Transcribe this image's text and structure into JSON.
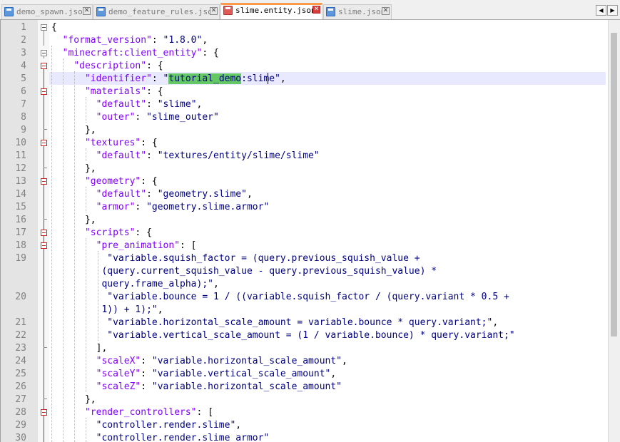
{
  "tabs": [
    {
      "label": "demo_spawn.json",
      "active": false
    },
    {
      "label": "demo_feature_rules.json",
      "active": false
    },
    {
      "label": "slime.entity.json",
      "active": true
    },
    {
      "label": "slime.json",
      "active": false
    }
  ],
  "tab_close_glyph": "✕",
  "tab_nav": {
    "prev": "◀",
    "next": "▶"
  },
  "colors": {
    "key": "#8000ff",
    "string": "#000080",
    "selection_highlight": "#64c864",
    "current_line": "#e8e8ff",
    "active_tab_accent": "#fa9c4b",
    "fold_marker_active": "#d21e1e"
  },
  "icons": {
    "tab_file_icon": "file-icon",
    "tab_close_icon": "close-icon",
    "fold_icon": "fold-minus-icon"
  },
  "highlighted_text": "tutorial_demo",
  "lines": [
    {
      "num": "1",
      "rows": [
        [
          {
            "t": "{",
            "c": "op"
          }
        ]
      ]
    },
    {
      "num": "2",
      "rows": [
        [
          {
            "t": "  ",
            "c": "op"
          },
          {
            "t": "\"format_version\"",
            "c": "key"
          },
          {
            "t": ": ",
            "c": "op"
          },
          {
            "t": "\"1.8.0\"",
            "c": "str"
          },
          {
            "t": ",",
            "c": "op"
          }
        ]
      ]
    },
    {
      "num": "3",
      "rows": [
        [
          {
            "t": "  ",
            "c": "op"
          },
          {
            "t": "\"minecraft:client_entity\"",
            "c": "key"
          },
          {
            "t": ": {",
            "c": "op"
          }
        ]
      ]
    },
    {
      "num": "4",
      "rows": [
        [
          {
            "t": "    ",
            "c": "op"
          },
          {
            "t": "\"description\"",
            "c": "key"
          },
          {
            "t": ": {",
            "c": "op"
          }
        ]
      ]
    },
    {
      "num": "5",
      "rows": [
        [
          {
            "t": "      ",
            "c": "op"
          },
          {
            "t": "\"identifier\"",
            "c": "key"
          },
          {
            "t": ": ",
            "c": "op"
          },
          {
            "t": "\"",
            "c": "str"
          },
          {
            "t": "tutorial_demo",
            "c": "str",
            "hl": true
          },
          {
            "t": ":slime\"",
            "c": "str"
          },
          {
            "t": ",",
            "c": "op"
          }
        ]
      ]
    },
    {
      "num": "6",
      "rows": [
        [
          {
            "t": "      ",
            "c": "op"
          },
          {
            "t": "\"materials\"",
            "c": "key"
          },
          {
            "t": ": {",
            "c": "op"
          }
        ]
      ]
    },
    {
      "num": "7",
      "rows": [
        [
          {
            "t": "        ",
            "c": "op"
          },
          {
            "t": "\"default\"",
            "c": "key"
          },
          {
            "t": ": ",
            "c": "op"
          },
          {
            "t": "\"slime\"",
            "c": "str"
          },
          {
            "t": ",",
            "c": "op"
          }
        ]
      ]
    },
    {
      "num": "8",
      "rows": [
        [
          {
            "t": "        ",
            "c": "op"
          },
          {
            "t": "\"outer\"",
            "c": "key"
          },
          {
            "t": ": ",
            "c": "op"
          },
          {
            "t": "\"slime_outer\"",
            "c": "str"
          }
        ]
      ]
    },
    {
      "num": "9",
      "rows": [
        [
          {
            "t": "      },",
            "c": "op"
          }
        ]
      ]
    },
    {
      "num": "10",
      "rows": [
        [
          {
            "t": "      ",
            "c": "op"
          },
          {
            "t": "\"textures\"",
            "c": "key"
          },
          {
            "t": ": {",
            "c": "op"
          }
        ]
      ]
    },
    {
      "num": "11",
      "rows": [
        [
          {
            "t": "        ",
            "c": "op"
          },
          {
            "t": "\"default\"",
            "c": "key"
          },
          {
            "t": ": ",
            "c": "op"
          },
          {
            "t": "\"textures/entity/slime/slime\"",
            "c": "str"
          }
        ]
      ]
    },
    {
      "num": "12",
      "rows": [
        [
          {
            "t": "      },",
            "c": "op"
          }
        ]
      ]
    },
    {
      "num": "13",
      "rows": [
        [
          {
            "t": "      ",
            "c": "op"
          },
          {
            "t": "\"geometry\"",
            "c": "key"
          },
          {
            "t": ": {",
            "c": "op"
          }
        ]
      ]
    },
    {
      "num": "14",
      "rows": [
        [
          {
            "t": "        ",
            "c": "op"
          },
          {
            "t": "\"default\"",
            "c": "key"
          },
          {
            "t": ": ",
            "c": "op"
          },
          {
            "t": "\"geometry.slime\"",
            "c": "str"
          },
          {
            "t": ",",
            "c": "op"
          }
        ]
      ]
    },
    {
      "num": "15",
      "rows": [
        [
          {
            "t": "        ",
            "c": "op"
          },
          {
            "t": "\"armor\"",
            "c": "key"
          },
          {
            "t": ": ",
            "c": "op"
          },
          {
            "t": "\"geometry.slime.armor\"",
            "c": "str"
          }
        ]
      ]
    },
    {
      "num": "16",
      "rows": [
        [
          {
            "t": "      },",
            "c": "op"
          }
        ]
      ]
    },
    {
      "num": "17",
      "rows": [
        [
          {
            "t": "      ",
            "c": "op"
          },
          {
            "t": "\"scripts\"",
            "c": "key"
          },
          {
            "t": ": {",
            "c": "op"
          }
        ]
      ]
    },
    {
      "num": "18",
      "rows": [
        [
          {
            "t": "        ",
            "c": "op"
          },
          {
            "t": "\"pre_animation\"",
            "c": "key"
          },
          {
            "t": ": [",
            "c": "op"
          }
        ]
      ]
    },
    {
      "num": "19",
      "rows": [
        [
          {
            "t": "          ",
            "c": "op"
          },
          {
            "t": "\"variable.squish_factor = (query.previous_squish_value +",
            "c": "str"
          }
        ],
        [
          {
            "t": "         ",
            "c": "op"
          },
          {
            "t": "(query.current_squish_value - query.previous_squish_value) *",
            "c": "str"
          }
        ],
        [
          {
            "t": "         ",
            "c": "op"
          },
          {
            "t": "query.frame_alpha);\"",
            "c": "str"
          },
          {
            "t": ",",
            "c": "op"
          }
        ]
      ]
    },
    {
      "num": "20",
      "rows": [
        [
          {
            "t": "          ",
            "c": "op"
          },
          {
            "t": "\"variable.bounce = 1 / ((variable.squish_factor / (query.variant * 0.5 +",
            "c": "str"
          }
        ],
        [
          {
            "t": "         ",
            "c": "op"
          },
          {
            "t": "1)) + 1);\"",
            "c": "str"
          },
          {
            "t": ",",
            "c": "op"
          }
        ]
      ]
    },
    {
      "num": "21",
      "rows": [
        [
          {
            "t": "          ",
            "c": "op"
          },
          {
            "t": "\"variable.horizontal_scale_amount = variable.bounce * query.variant;\"",
            "c": "str"
          },
          {
            "t": ",",
            "c": "op"
          }
        ]
      ]
    },
    {
      "num": "22",
      "rows": [
        [
          {
            "t": "          ",
            "c": "op"
          },
          {
            "t": "\"variable.vertical_scale_amount = (1 / variable.bounce) * query.variant;\"",
            "c": "str"
          }
        ]
      ]
    },
    {
      "num": "23",
      "rows": [
        [
          {
            "t": "        ],",
            "c": "op"
          }
        ]
      ]
    },
    {
      "num": "24",
      "rows": [
        [
          {
            "t": "        ",
            "c": "op"
          },
          {
            "t": "\"scaleX\"",
            "c": "key"
          },
          {
            "t": ": ",
            "c": "op"
          },
          {
            "t": "\"variable.horizontal_scale_amount\"",
            "c": "str"
          },
          {
            "t": ",",
            "c": "op"
          }
        ]
      ]
    },
    {
      "num": "25",
      "rows": [
        [
          {
            "t": "        ",
            "c": "op"
          },
          {
            "t": "\"scaleY\"",
            "c": "key"
          },
          {
            "t": ": ",
            "c": "op"
          },
          {
            "t": "\"variable.vertical_scale_amount\"",
            "c": "str"
          },
          {
            "t": ",",
            "c": "op"
          }
        ]
      ]
    },
    {
      "num": "26",
      "rows": [
        [
          {
            "t": "        ",
            "c": "op"
          },
          {
            "t": "\"scaleZ\"",
            "c": "key"
          },
          {
            "t": ": ",
            "c": "op"
          },
          {
            "t": "\"variable.horizontal_scale_amount\"",
            "c": "str"
          }
        ]
      ]
    },
    {
      "num": "27",
      "rows": [
        [
          {
            "t": "      },",
            "c": "op"
          }
        ]
      ]
    },
    {
      "num": "28",
      "rows": [
        [
          {
            "t": "      ",
            "c": "op"
          },
          {
            "t": "\"render_controllers\"",
            "c": "key"
          },
          {
            "t": ": [",
            "c": "op"
          }
        ]
      ]
    },
    {
      "num": "29",
      "rows": [
        [
          {
            "t": "        ",
            "c": "op"
          },
          {
            "t": "\"controller.render.slime\"",
            "c": "str"
          },
          {
            "t": ",",
            "c": "op"
          }
        ]
      ]
    },
    {
      "num": "30",
      "rows": [
        [
          {
            "t": "        ",
            "c": "op"
          },
          {
            "t": "\"controller.render.slime_armor\"",
            "c": "str"
          }
        ]
      ]
    }
  ]
}
